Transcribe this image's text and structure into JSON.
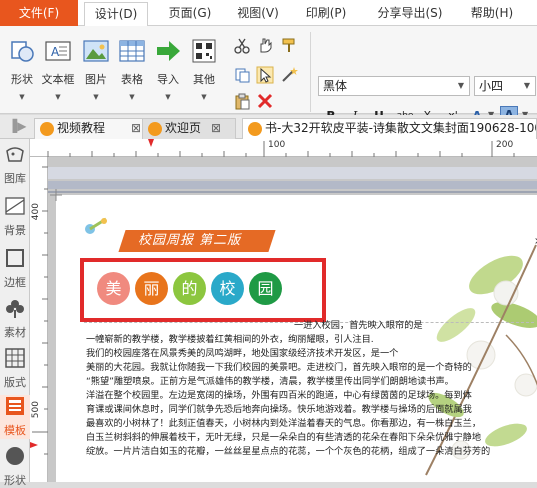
{
  "menubar": {
    "file": "文件(F)",
    "tabs": [
      "设计(D)",
      "页面(G)",
      "视图(V)",
      "印刷(P)",
      "分享导出(S)",
      "帮助(H)"
    ]
  },
  "ribbon": {
    "buttons": [
      "形状",
      "文本框",
      "图片",
      "表格",
      "导入",
      "其他"
    ],
    "font_name": "黑体",
    "font_size": "小四",
    "format": {
      "bold": "B",
      "italic": "I",
      "underline": "U",
      "strike": "abe",
      "sub": "X,",
      "sup": "x'",
      "color": "A"
    }
  },
  "doc_tabs": [
    {
      "label": "视频教程",
      "close": "⊠"
    },
    {
      "label": "欢迎页",
      "close": "⊠"
    },
    {
      "label": "书-大32开软皮平装-诗集散文文集封面190628-1004.c",
      "close": ""
    }
  ],
  "sidebar": [
    "图库",
    "背景",
    "边框",
    "素材",
    "版式",
    "模板",
    "形状"
  ],
  "ruler": {
    "top_marks": [
      "100",
      "200"
    ],
    "left_marks": [
      "400",
      "500"
    ]
  },
  "document": {
    "header_title": "校园周报  第二版",
    "circles": [
      {
        "char": "美",
        "color": "#f08a7f"
      },
      {
        "char": "丽",
        "color": "#e8741c"
      },
      {
        "char": "的",
        "color": "#8cc63f"
      },
      {
        "char": "校",
        "color": "#2aa9c9"
      },
      {
        "char": "园",
        "color": "#1f9a45"
      }
    ],
    "paragraph_lines": [
      "一进入校园，首先映入眼帘的是",
      "一幢崭新的教学楼，教学楼披着红黄相间的外衣，绚丽耀眼，引人注目.",
      "我们的校园座落在风景秀美的凤鸣湖畔，地处国家级经济技术开发区，是一个",
      "美丽的大花园。我就让你随我一下我们校园的美景吧。走进校门，首先映入眼帘的是一个奇特的",
      "“熊望”雕塑喷泉。正前方是气派雄伟的教学楼，清晨，教学楼里传出同学们朗朗地读书声。",
      "洋溢在整个校园里。左边是宽阔的操场，外围有四百米的跑道，中心有绿茵茵的足球场。每到体",
      "育课或课间休息时，同学们就争先恐后地奔向操场。快乐地游戏着。教学楼与操场的后面就属我",
      "最喜欢的小树林了！此刻正值春天，小树林内到处洋溢着春天的气息。你看那边，有一株白玉兰，",
      "白玉兰树斜斜的伸展着枝干，无叶无绿，只是一朵朵白的有些清透的花朵在春阳下朵朵优雅宁静地",
      "绽放。一片片洁白如玉的花瓣，一丝丝星星点点的花蕊，一个个灰色的花柄，组成了一朵清白芬芳的"
    ]
  }
}
